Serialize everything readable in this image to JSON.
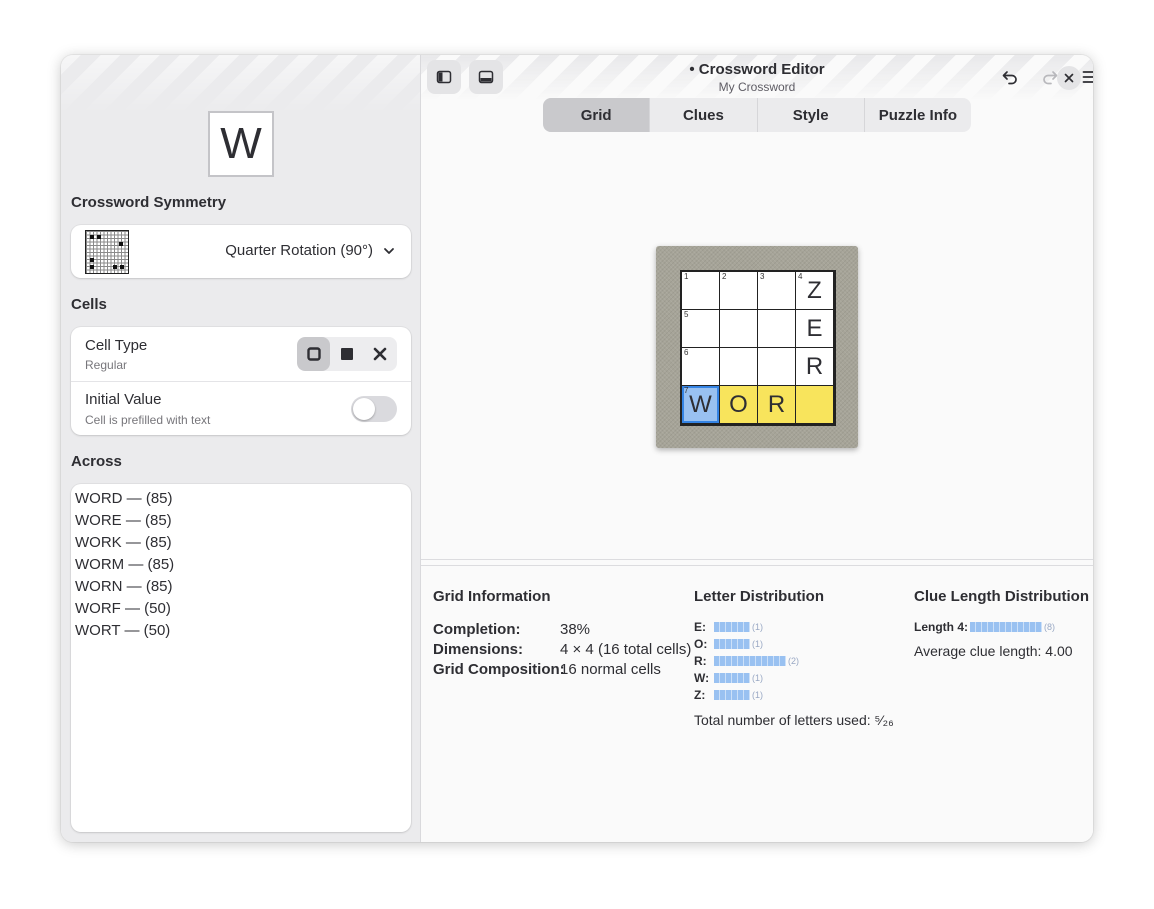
{
  "header": {
    "title": "Crossword Editor",
    "modified_dot": "•",
    "subtitle": "My Crossword"
  },
  "tabs": [
    {
      "label": "Grid",
      "active": true
    },
    {
      "label": "Clues",
      "active": false
    },
    {
      "label": "Style",
      "active": false
    },
    {
      "label": "Puzzle Info",
      "active": false
    }
  ],
  "sidebar": {
    "current_letter": "W",
    "symmetry_title": "Crossword Symmetry",
    "symmetry_value": "Quarter Rotation (90°)",
    "cells_title": "Cells",
    "cell_type_label": "Cell Type",
    "cell_type_value": "Regular",
    "initial_value_label": "Initial Value",
    "initial_value_sub": "Cell is prefilled with text",
    "initial_value_on": false,
    "across_title": "Across",
    "across_items": [
      "WORD — (85)",
      "WORE — (85)",
      "WORK — (85)",
      "WORM — (85)",
      "WORN — (85)",
      "WORF — (50)",
      "WORT — (50)"
    ]
  },
  "grid": {
    "rows": [
      [
        {
          "num": "1",
          "letter": ""
        },
        {
          "num": "2",
          "letter": ""
        },
        {
          "num": "3",
          "letter": ""
        },
        {
          "num": "4",
          "letter": "Z"
        }
      ],
      [
        {
          "num": "5",
          "letter": ""
        },
        {
          "num": "",
          "letter": ""
        },
        {
          "num": "",
          "letter": ""
        },
        {
          "num": "",
          "letter": "E"
        }
      ],
      [
        {
          "num": "6",
          "letter": ""
        },
        {
          "num": "",
          "letter": ""
        },
        {
          "num": "",
          "letter": ""
        },
        {
          "num": "",
          "letter": "R"
        }
      ],
      [
        {
          "num": "7",
          "letter": "W"
        },
        {
          "num": "",
          "letter": "O"
        },
        {
          "num": "",
          "letter": "R"
        },
        {
          "num": "",
          "letter": ""
        }
      ]
    ],
    "highlight_color": "#f8e45c",
    "selected_color": "#99c1f1"
  },
  "info": {
    "grid_info_title": "Grid Information",
    "completion_label": "Completion:",
    "completion_value": "38%",
    "dimensions_label": "Dimensions:",
    "dimensions_value": "4 × 4 (16 total cells)",
    "composition_label": "Grid Composition:",
    "composition_value": "16 normal cells",
    "letter_dist_title": "Letter Distribution",
    "letters": [
      {
        "letter": "E:",
        "count": 1,
        "count_label": "(1)"
      },
      {
        "letter": "O:",
        "count": 1,
        "count_label": "(1)"
      },
      {
        "letter": "R:",
        "count": 2,
        "count_label": "(2)"
      },
      {
        "letter": "W:",
        "count": 1,
        "count_label": "(1)"
      },
      {
        "letter": "Z:",
        "count": 1,
        "count_label": "(1)"
      }
    ],
    "total_letters": "Total number of letters used: ⁵⁄₂₆",
    "clue_len_title": "Clue Length Distribution",
    "clue_length_label": "Length 4:",
    "clue_length_count": 8,
    "clue_length_count_label": "(8)",
    "average_clue_length": "Average clue length: 4.00"
  }
}
